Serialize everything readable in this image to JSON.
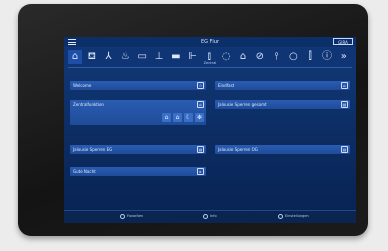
{
  "header": {
    "title": "EG Flur",
    "menu_icon": "hamburger-icon",
    "brand_label": "GIRA"
  },
  "category_icons": [
    {
      "name": "home-icon",
      "glyph": "⌂",
      "active": true
    },
    {
      "name": "sofa-icon",
      "glyph": "⛾"
    },
    {
      "name": "dining-icon",
      "glyph": "⅄"
    },
    {
      "name": "kitchen-icon",
      "glyph": "♨"
    },
    {
      "name": "cabinet-icon",
      "glyph": "▭"
    },
    {
      "name": "lamp-icon",
      "glyph": "⊥"
    },
    {
      "name": "bed-icon",
      "glyph": "▬"
    },
    {
      "name": "stairs-icon",
      "glyph": "⊩"
    },
    {
      "name": "chart-icon",
      "glyph": "⫾"
    },
    {
      "name": "bulb-icon",
      "glyph": "◌"
    },
    {
      "name": "house-outline-icon",
      "glyph": "⌂"
    },
    {
      "name": "tag-icon",
      "glyph": "⊘"
    },
    {
      "name": "temperature-icon",
      "glyph": "⫯"
    },
    {
      "name": "circle-icon",
      "glyph": "○"
    },
    {
      "name": "bar-chart-icon",
      "glyph": "⫿"
    },
    {
      "name": "info-icon",
      "glyph": "ⓘ"
    },
    {
      "name": "more-icon",
      "glyph": "»"
    }
  ],
  "category_label": "Zentral",
  "tiles": {
    "welcome": {
      "label": "Welcome",
      "icon": "star-icon",
      "glyph": "☆"
    },
    "zentral": {
      "label": "Zentralfunktion",
      "icon": "house-icon",
      "glyph": "⌂"
    },
    "scene1": {
      "label": "Jalousie Sperren EG",
      "icon": "blind-icon",
      "glyph": "▤"
    },
    "night": {
      "label": "Gute Nacht",
      "icon": "arrow-right-icon",
      "glyph": "▸"
    },
    "frontdoor": {
      "label": "Eindfast",
      "icon": "house-icon",
      "glyph": "⌂"
    },
    "scene2": {
      "label": "Jalousie Sperren gesamt",
      "icon": "blind-icon",
      "glyph": "▤"
    },
    "scene3": {
      "label": "Jalousie Sperren OG",
      "icon": "blind-icon",
      "glyph": "▤"
    }
  },
  "sub_buttons": [
    {
      "name": "house-icon",
      "glyph": "⌂"
    },
    {
      "name": "house-outline-icon",
      "glyph": "⌂"
    },
    {
      "name": "moon-icon",
      "glyph": "☾"
    },
    {
      "name": "gear-icon",
      "glyph": "✻"
    }
  ],
  "bottom_bar": [
    {
      "name": "favorites",
      "label": "Favoriten",
      "icon": "star-icon"
    },
    {
      "name": "info",
      "label": "Info",
      "icon": "info-icon"
    },
    {
      "name": "settings",
      "label": "Einstellungen",
      "icon": "gear-icon"
    }
  ]
}
